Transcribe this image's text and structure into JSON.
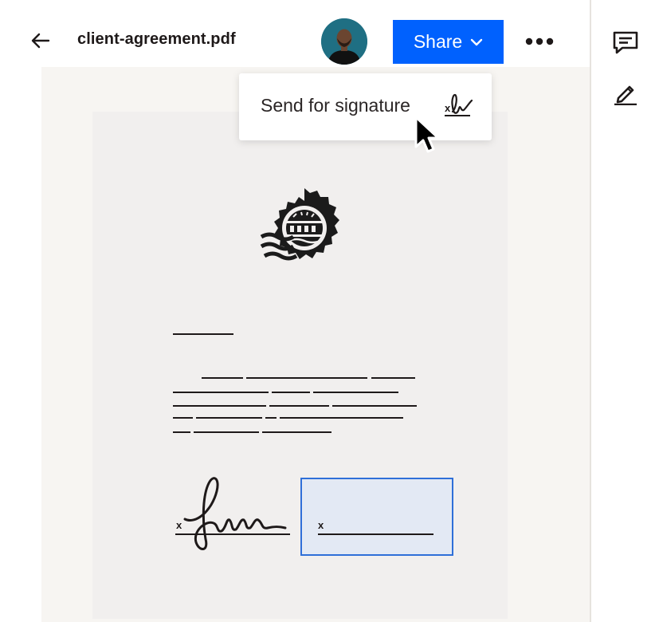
{
  "header": {
    "back_icon": "arrow-left-icon",
    "file_name": "client-agreement.pdf",
    "avatar_alt": "user-avatar",
    "share_label": "Share",
    "share_color": "#0061fe",
    "more_icon": "ellipsis-icon"
  },
  "menu": {
    "item_label": "Send for signature",
    "item_icon": "signature-icon"
  },
  "sidebar": {
    "items": [
      {
        "icon": "comment-icon"
      },
      {
        "icon": "pencil-icon"
      }
    ]
  },
  "document": {
    "seal_icon": "stamp-seal-icon",
    "signature_mark": "x",
    "signature_field_mark": "x",
    "field_color": "#e3e9f4",
    "field_border": "#2f6fd8"
  }
}
